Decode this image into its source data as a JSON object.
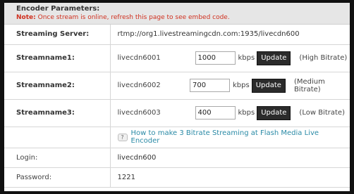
{
  "header": {
    "title": "Encoder Parameters:",
    "note_prefix": "Note:",
    "note_text": "Once stream is online, refresh this page to see embed code."
  },
  "server": {
    "label": "Streaming Server:",
    "value": "rtmp://org1.livestreamingcdn.com:1935/livecdn600"
  },
  "streams": [
    {
      "label": "Streamname1:",
      "name": "livecdn6001",
      "bitrate": "1000",
      "unit": "kbps",
      "button": "Update",
      "quality": "(High Bitrate)"
    },
    {
      "label": "Streamname2:",
      "name": "livecdn6002",
      "bitrate": "700",
      "unit": "kbps",
      "button": "Update",
      "quality": "(Medium Bitrate)"
    },
    {
      "label": "Streamname3:",
      "name": "livecdn6003",
      "bitrate": "400",
      "unit": "kbps",
      "button": "Update",
      "quality": "(Low Bitrate)"
    }
  ],
  "help": {
    "icon": "question-icon",
    "icon_glyph": "?",
    "link_text": "How to make 3 Bitrate Streaming at Flash Media Live Encoder"
  },
  "login": {
    "label": "Login:",
    "value": "livecdn600"
  },
  "password": {
    "label": "Password:",
    "value": "1221"
  },
  "colors": {
    "note_red": "#d0301f",
    "link_blue": "#2a8aa6",
    "button_dark": "#2b2b2b"
  }
}
